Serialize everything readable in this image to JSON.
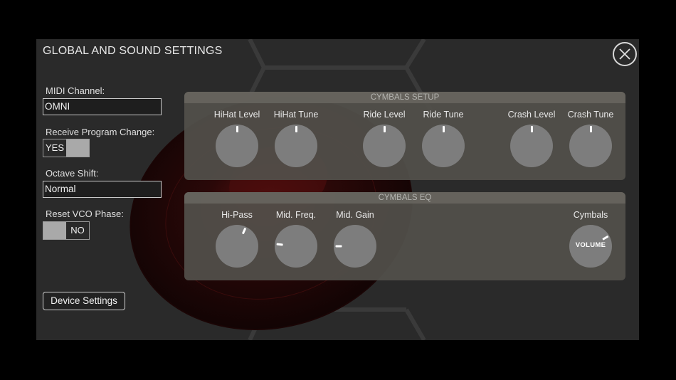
{
  "title": "GLOBAL AND SOUND SETTINGS",
  "midi_channel": {
    "label": "MIDI Channel:",
    "value": "OMNI"
  },
  "program_change": {
    "label": "Receive Program Change:",
    "state": "YES"
  },
  "octave_shift": {
    "label": "Octave Shift:",
    "value": "Normal"
  },
  "reset_vco": {
    "label": "Reset VCO Phase:",
    "state": "NO"
  },
  "device_settings_label": "Device Settings",
  "cymbals_setup": {
    "header": "CYMBALS SETUP",
    "knobs": [
      {
        "label": "HiHat Level",
        "value": 0.5
      },
      {
        "label": "HiHat Tune",
        "value": 0.5
      },
      {
        "label": "Ride Level",
        "value": 0.5
      },
      {
        "label": "Ride Tune",
        "value": 0.5
      },
      {
        "label": "Crash Level",
        "value": 0.5
      },
      {
        "label": "Crash Tune",
        "value": 0.5
      }
    ]
  },
  "cymbals_eq": {
    "header": "CYMBALS EQ",
    "knobs": [
      {
        "label": "Hi-Pass",
        "value": 0.58
      },
      {
        "label": "Mid. Freq.",
        "value": 0.22
      },
      {
        "label": "Mid. Gain",
        "value": 0.2
      }
    ],
    "volume": {
      "label": "Cymbals",
      "inner_label": "VOLUME",
      "value": 0.7
    }
  }
}
